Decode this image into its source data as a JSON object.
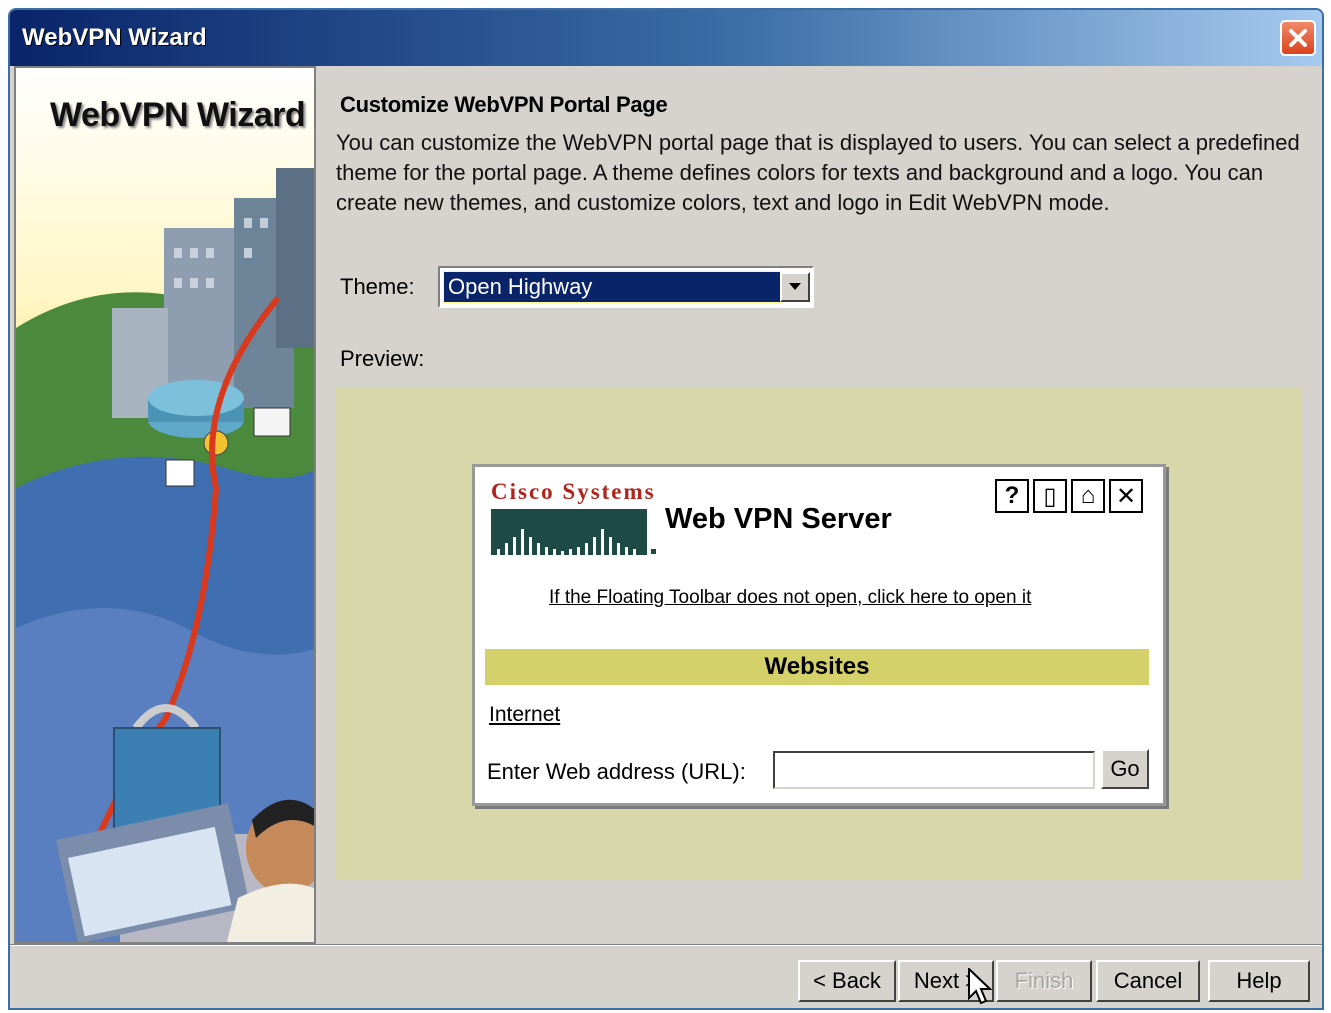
{
  "window": {
    "title": "WebVPN Wizard"
  },
  "left_panel": {
    "title": "WebVPN Wizard"
  },
  "content": {
    "heading": "Customize WebVPN Portal Page",
    "description": "You can customize the WebVPN portal page that is displayed to users. You can select a predefined theme for the portal page. A theme defines colors for texts and background and a logo. You can create new themes, and customize colors, text and logo in Edit WebVPN mode.",
    "theme_label": "Theme:",
    "theme_value": "Open Highway",
    "preview_label": "Preview:"
  },
  "preview": {
    "brand": "Cisco Systems",
    "server_title": "Web VPN Server",
    "toolbar_icons": [
      "help-icon",
      "toolbar-icon",
      "home-icon",
      "close-icon"
    ],
    "toolbar_glyphs": [
      "?",
      "▯",
      "⌂",
      "✕"
    ],
    "floating_toolbar_link": "If the Floating Toolbar does not open, click here to open it",
    "websites_header": "Websites",
    "internet_link": "Internet",
    "url_label": "Enter Web address (URL):",
    "url_value": "",
    "go_label": "Go"
  },
  "buttons": {
    "back": "< Back",
    "next": "Next >",
    "finish": "Finish",
    "cancel": "Cancel",
    "help": "Help"
  },
  "colors": {
    "titlebar_start": "#0a246a",
    "titlebar_end": "#a6caf0",
    "dialog_bg": "#d6d3ce",
    "preview_bg": "#d8d7a9",
    "websites_bar": "#d4d06a",
    "cisco_red": "#b0241c",
    "selection": "#0a246a"
  }
}
